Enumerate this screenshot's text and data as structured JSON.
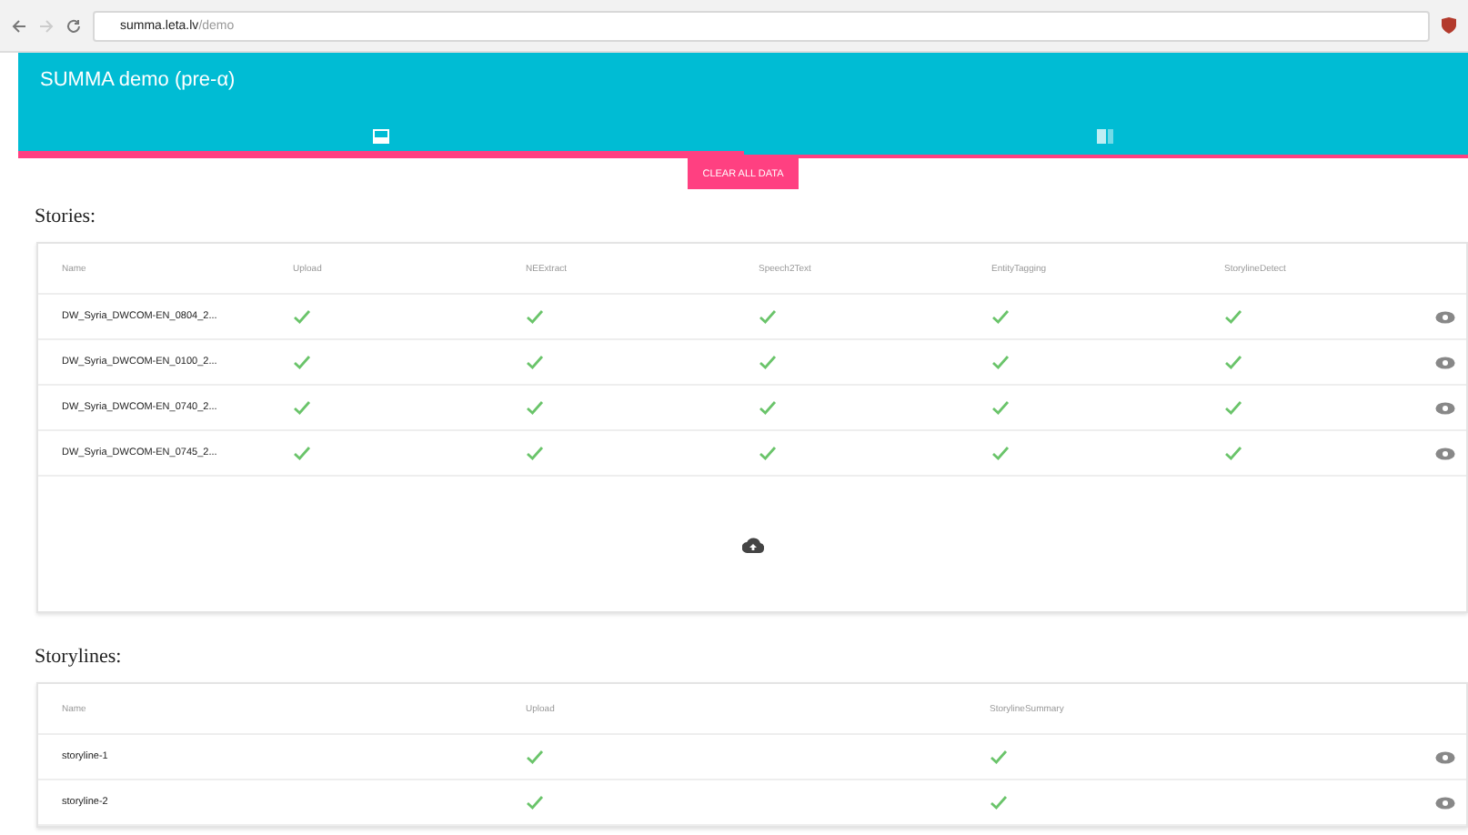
{
  "browser": {
    "url_host": "summa.leta.lv",
    "url_path": "/demo"
  },
  "app": {
    "title": "SUMMA demo (pre-α)"
  },
  "tabs": [
    {
      "kind": "stories",
      "selected": true
    },
    {
      "kind": "storylines",
      "selected": false
    }
  ],
  "clear_button": "CLEAR ALL DATA",
  "stories": {
    "heading": "Stories:",
    "columns": [
      "Name",
      "Upload",
      "NEExtract",
      "Speech2Text",
      "EntityTagging",
      "StorylineDetect"
    ],
    "rows": [
      {
        "name": "DW_Syria_DWCOM-EN_0804_2...",
        "steps": [
          true,
          true,
          true,
          true,
          true
        ]
      },
      {
        "name": "DW_Syria_DWCOM-EN_0100_2...",
        "steps": [
          true,
          true,
          true,
          true,
          true
        ]
      },
      {
        "name": "DW_Syria_DWCOM-EN_0740_2...",
        "steps": [
          true,
          true,
          true,
          true,
          true
        ]
      },
      {
        "name": "DW_Syria_DWCOM-EN_0745_2...",
        "steps": [
          true,
          true,
          true,
          true,
          true
        ]
      }
    ]
  },
  "storylines": {
    "heading": "Storylines:",
    "columns": [
      "Name",
      "Upload",
      "StorylineSummary"
    ],
    "rows": [
      {
        "name": "storyline-1",
        "steps": [
          true,
          true
        ]
      },
      {
        "name": "storyline-2",
        "steps": [
          true,
          true
        ]
      }
    ]
  }
}
